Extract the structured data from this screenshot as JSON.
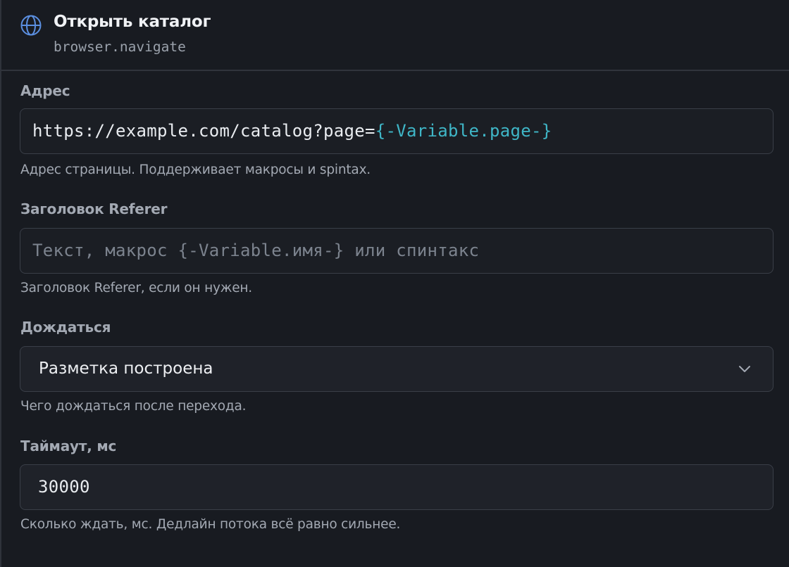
{
  "header": {
    "title": "Открыть каталог",
    "subtitle": "browser.navigate",
    "icon": "globe-icon"
  },
  "fields": {
    "address": {
      "label": "Адрес",
      "value_plain": "https://example.com/catalog?page=",
      "value_macro": "{-Variable.page-}",
      "hint": "Адрес страницы. Поддерживает макросы и spintax."
    },
    "referer": {
      "label": "Заголовок Referer",
      "placeholder": "Текст, макрос {-Variable.имя-} или спинтакс",
      "hint": "Заголовок Referer, если он нужен."
    },
    "wait": {
      "label": "Дождаться",
      "selected": "Разметка построена",
      "icon": "chevron-down-icon",
      "hint": "Чего дождаться после перехода."
    },
    "timeout": {
      "label": "Таймаут, мс",
      "value": "30000",
      "hint": "Сколько ждать, мс. Дедлайн потока всё равно сильнее."
    }
  },
  "colors": {
    "background": "#181b21",
    "macro": "#3fb6c7",
    "icon_accent": "#5b8fe0"
  }
}
